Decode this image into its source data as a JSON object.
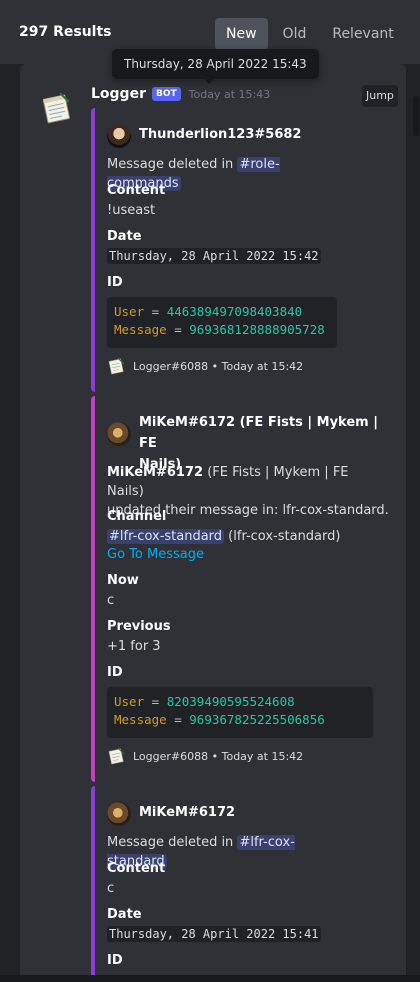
{
  "header": {
    "results_count": "297 Results",
    "sort_tabs": [
      {
        "label": "New",
        "active": true
      },
      {
        "label": "Old",
        "active": false
      },
      {
        "label": "Relevant",
        "active": false
      }
    ],
    "tooltip": "Thursday, 28 April 2022 15:43"
  },
  "message": {
    "username": "Logger",
    "bot_tag": "BOT",
    "timestamp": "Today at 15:43",
    "jump_label": "Jump",
    "avatar_icon": "notepad-icon"
  },
  "embeds": [
    {
      "color": "#8b3ddb",
      "author": "Thunderlion123#5682",
      "description_prefix": "Message deleted in ",
      "channel_hash": "#",
      "channel": "role-commands",
      "fields": {
        "content_label": "Content",
        "content_value": "!useast",
        "date_label": "Date",
        "date_value": "Thursday, 28 April 2022 15:42",
        "id_label": "ID"
      },
      "code": {
        "user_key": "User",
        "user_val": "446389497098403840",
        "msg_key": "Message",
        "msg_val": "969368128888905728",
        "eq": "="
      },
      "footer": "Logger#6088 • Today at 15:42"
    },
    {
      "color": "#c93ec4",
      "author_line1": "MiKeM#6172 (FE Fists | Mykem | FE",
      "author_line2": "Nails)",
      "description_bold": "MiKeM#6172",
      "description_rest1": " (FE Fists | Mykem | FE Nails)",
      "description_rest2": "updated their message in: lfr-cox-standard.",
      "fields": {
        "channel_label": "Channel",
        "channel_hash": "#",
        "channel_name": "lfr-cox-standard",
        "channel_suffix": " (lfr-cox-standard)",
        "goto_link": "Go To Message",
        "now_label": "Now",
        "now_value": "c",
        "previous_label": "Previous",
        "previous_value": "+1 for 3",
        "id_label": "ID"
      },
      "code": {
        "user_key": "User",
        "user_val": "82039490595524608",
        "msg_key": "Message",
        "msg_val": "969367825225506856",
        "eq": "="
      },
      "footer": "Logger#6088 • Today at 15:42"
    },
    {
      "color": "#8b3ddb",
      "author": "MiKeM#6172",
      "description_prefix": "Message deleted in ",
      "channel_hash": "#",
      "channel": "lfr-cox-standard",
      "fields": {
        "content_label": "Content",
        "content_value": "c",
        "date_label": "Date",
        "date_value": "Thursday, 28 April 2022 15:41",
        "id_label": "ID"
      }
    }
  ]
}
